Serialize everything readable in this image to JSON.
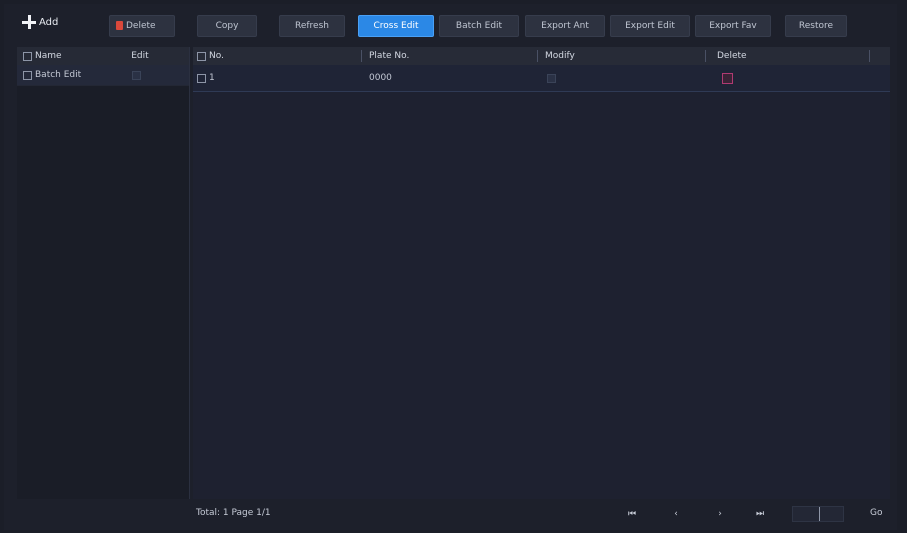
{
  "toolbar": {
    "add_label": "Add",
    "delete_label": "Delete",
    "buttons": [
      {
        "label": "Copy",
        "active": false
      },
      {
        "label": "Refresh",
        "active": false
      },
      {
        "label": "Cross Edit",
        "active": true
      },
      {
        "label": "Batch Edit",
        "active": false
      },
      {
        "label": "Export Ant",
        "active": false
      },
      {
        "label": "Export Edit",
        "active": false
      },
      {
        "label": "Export Fav",
        "active": false
      },
      {
        "label": "Restore",
        "active": false
      }
    ]
  },
  "left_panel": {
    "headers": [
      "Name",
      "Edit"
    ],
    "rows": [
      {
        "name": "Batch Edit",
        "selected": true
      }
    ]
  },
  "grid": {
    "headers": [
      "No.",
      "Plate No.",
      "Modify",
      "Delete"
    ],
    "rows": [
      {
        "no": "1",
        "plate": "0000",
        "modify": "",
        "delete": ""
      }
    ]
  },
  "footer": {
    "info": "Total: 1  Page 1/1",
    "pager": [
      "⏮",
      "‹",
      "›",
      "⏭"
    ],
    "go_label": "Go"
  },
  "colors": {
    "accent": "#2b88e6",
    "danger": "#d9483b",
    "pink": "#b03a72"
  }
}
